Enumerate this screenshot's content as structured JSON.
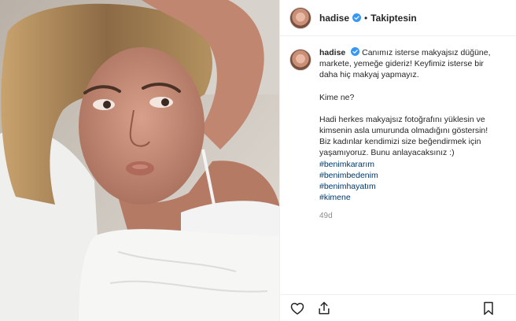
{
  "post": {
    "username": "hadise",
    "follow_state": "Takiptesin",
    "separator": "•",
    "caption": {
      "username": "hadise",
      "line1": "Canımız isterse makyajsız düğüne, markete, yemeğe gideriz! Keyfimiz isterse bir daha hiç makyaj yapmayız.",
      "line2": "Kime ne?",
      "line3": "Hadi herkes makyajsız fotoğrafını yüklesin ve kimsenin asla umurunda olmadığını göstersin! Biz kadınlar kendimizi size beğendirmek için yaşamıyoruz. Bunu anlayacaksınız :)",
      "hashtags": [
        "#benimkararım",
        "#benimbedenim",
        "#benimhayatım",
        "#kimene"
      ]
    },
    "age": "49d"
  },
  "icons": {
    "verified": "verified-badge-icon",
    "like": "heart-icon",
    "share": "share-icon",
    "save": "bookmark-icon"
  },
  "colors": {
    "verified": "#3897f0",
    "hashtag": "#00376b",
    "muted": "#8e8e8e",
    "text": "#262626"
  }
}
